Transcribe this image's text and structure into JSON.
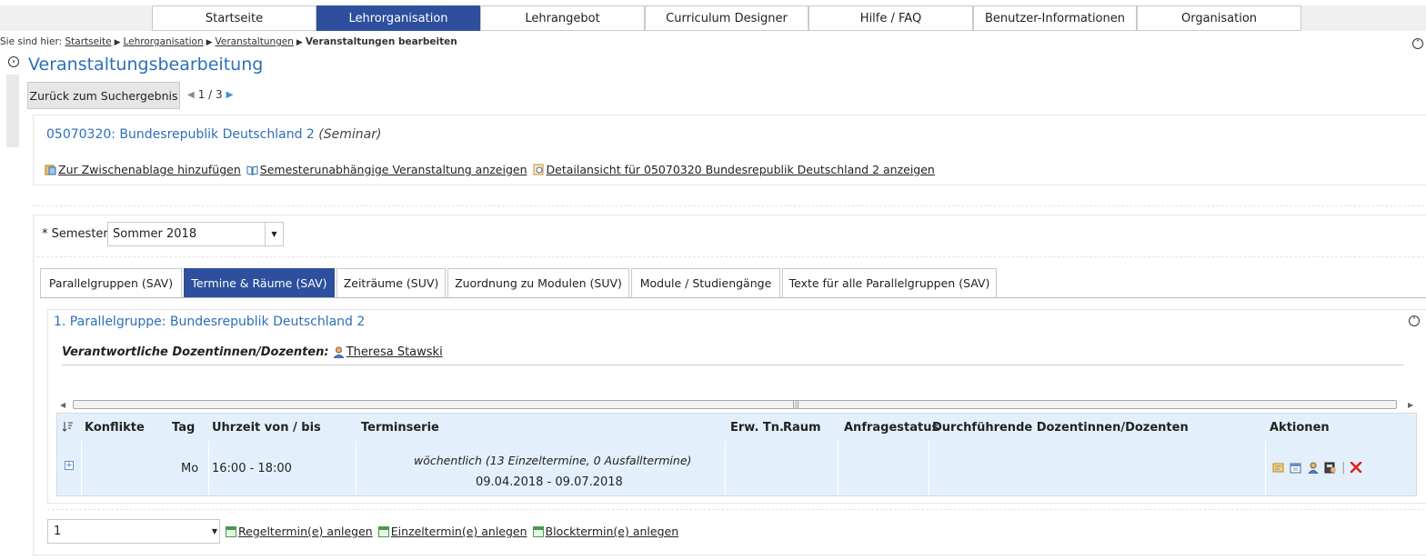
{
  "topnav": {
    "tabs": [
      {
        "label": "Startseite",
        "active": false
      },
      {
        "label": "Lehrorganisation",
        "active": true
      },
      {
        "label": "Lehrangebot",
        "active": false
      },
      {
        "label": "Curriculum Designer",
        "active": false
      },
      {
        "label": "Hilfe / FAQ",
        "active": false
      },
      {
        "label": "Benutzer-Informationen",
        "active": false
      },
      {
        "label": "Organisation",
        "active": false
      }
    ]
  },
  "breadcrumb": {
    "prefix": "Sie sind hier:",
    "items": [
      "Startseite",
      "Lehrorganisation",
      "Veranstaltungen"
    ],
    "current": "Veranstaltungen bearbeiten"
  },
  "page": {
    "title": "Veranstaltungsbearbeitung",
    "back_button": "Zurück zum Suchergebnis",
    "pager": "1 / 3"
  },
  "course": {
    "title": "05070320: Bundesrepublik Deutschland 2",
    "type": "(Seminar)",
    "links": [
      "Zur Zwischenablage hinzufügen",
      "Semesterunabhängige Veranstaltung anzeigen",
      "Detailansicht für 05070320 Bundesrepublik Deutschland 2 anzeigen"
    ]
  },
  "semester": {
    "label": "* Semester",
    "value": "Sommer 2018"
  },
  "tabs": [
    {
      "label": "Parallelgruppen (SAV)",
      "active": false
    },
    {
      "label": "Termine & Räume (SAV)",
      "active": true
    },
    {
      "label": "Zeiträume (SUV)",
      "active": false
    },
    {
      "label": "Zuordnung zu Modulen (SUV)",
      "active": false
    },
    {
      "label": "Module / Studiengänge",
      "active": false
    },
    {
      "label": "Texte für alle Parallelgruppen (SAV)",
      "active": false
    }
  ],
  "parallelgruppe": {
    "title": "1. Parallelgruppe: Bundesrepublik Deutschland 2",
    "dozent_label": "Verantwortliche Dozentinnen/Dozenten:",
    "dozent_name": "Theresa Stawski"
  },
  "table": {
    "columns": [
      "Konflikte",
      "Tag",
      "Uhrzeit von / bis",
      "Terminserie",
      "Erw. Tn.",
      "Raum",
      "Anfragestatus",
      "Durchführende Dozentinnen/Dozenten",
      "Aktionen"
    ],
    "rows": [
      {
        "konflikte": "",
        "tag": "Mo",
        "uhrzeit": "16:00 - 18:00",
        "terminserie_line1": "wöchentlich (13 Einzeltermine, 0 Ausfalltermine)",
        "terminserie_line2": "09.04.2018 - 09.07.2018",
        "erw_tn": "",
        "raum": "",
        "anfragestatus": "",
        "dozenten": ""
      }
    ]
  },
  "bottom": {
    "select_value": "1",
    "links": [
      "Regeltermin(e) anlegen",
      "Einzeltermin(e) anlegen",
      "Blocktermin(e) anlegen"
    ]
  },
  "colors": {
    "accent": "#2d4f9e",
    "link": "#2d6fb7",
    "table_bg": "#e3f0fb",
    "delete": "#d9261c"
  },
  "icons": {
    "clipboard": "clipboard-icon",
    "book": "book-icon",
    "magnifier": "detail-view-icon",
    "person": "person-icon",
    "calendar": "calendar-icon",
    "delete": "delete-icon"
  }
}
